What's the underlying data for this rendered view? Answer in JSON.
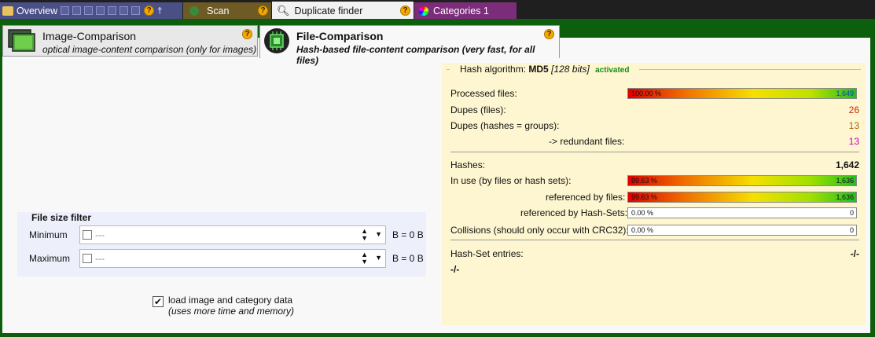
{
  "tabs": {
    "overview": "Overview",
    "scan": "Scan",
    "duplicate_finder": "Duplicate finder",
    "categories": "Categories 1"
  },
  "modes": {
    "image": {
      "title": "Image-Comparison",
      "subtitle": "optical image-content comparison (only for images)"
    },
    "file": {
      "title": "File-Comparison",
      "subtitle": "Hash-based file-content comparison (very fast, for all files)"
    }
  },
  "help_mark": "?",
  "filter": {
    "header": "File size filter",
    "min_label": "Minimum",
    "max_label": "Maximum",
    "min_value": "---",
    "max_value": "---",
    "min_unit": "B = 0 B",
    "max_unit": "B = 0 B"
  },
  "load_option": {
    "checked": true,
    "line1": "load image and category data",
    "line2": "(uses more time and memory)"
  },
  "hash": {
    "label": "Hash algorithm:",
    "algo": "MD5",
    "bits": "[128 bits]",
    "status": "activated",
    "processed_label": "Processed files:",
    "processed_pct": "100.00 %",
    "processed_count": "1,649",
    "dupes_files_label": "Dupes (files):",
    "dupes_files": "26",
    "dupes_hashes_label": "Dupes (hashes = groups):",
    "dupes_hashes": "13",
    "redundant_label": "-> redundant files:",
    "redundant": "13",
    "hashes_label": "Hashes:",
    "hashes": "1,642",
    "inuse_label": "In use (by files or hash sets):",
    "inuse_pct": "99.63 %",
    "inuse_count": "1,636",
    "refbyfiles_label": "referenced by files:",
    "refbyfiles_pct": "99.63 %",
    "refbyfiles_count": "1,636",
    "refbysets_label": "referenced by Hash-Sets:",
    "refbysets_pct": "0.00 %",
    "refbysets_count": "0",
    "collisions_label": "Collisions (should only occur with CRC32):",
    "collisions_pct": "0.00 %",
    "collisions_count": "0",
    "hashset_label": "Hash-Set entries:",
    "hashset_value": "-/-",
    "hashset_sub": "-/-"
  },
  "colors": {
    "frame_green": "#0d5e0d",
    "dupes_red": "#cc2200",
    "dupes_orange": "#b06000",
    "redundant_magenta": "#c000c0"
  }
}
